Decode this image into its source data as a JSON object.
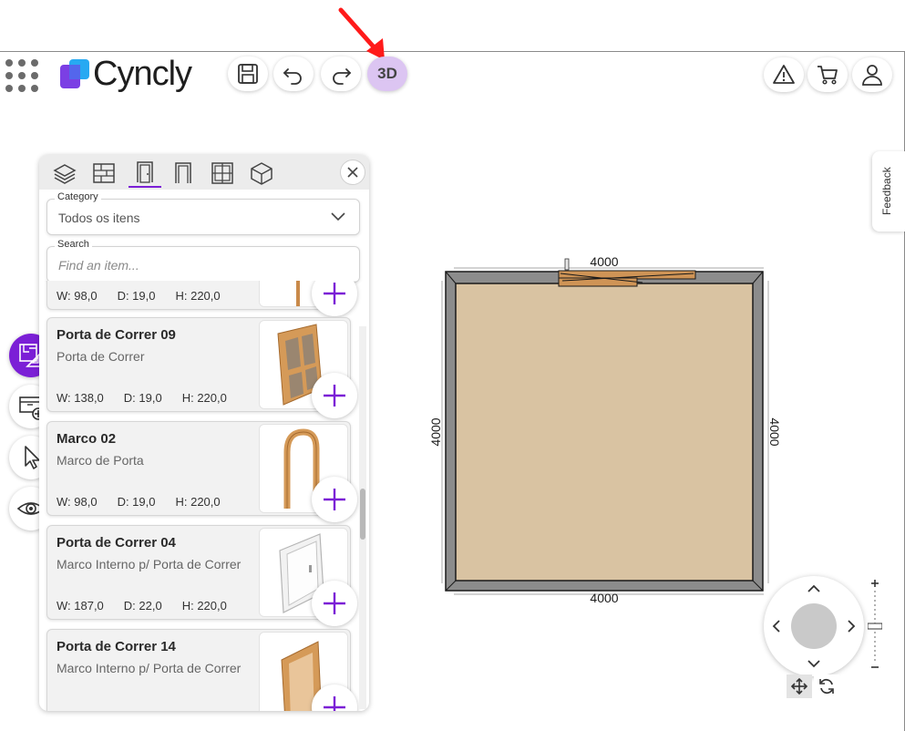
{
  "header": {
    "brand": "Cyncly",
    "mode_button_label": "3D",
    "brand_colors": {
      "accent": "#7b1fd6",
      "mode_pill": "#dcc5f2"
    },
    "icons": [
      "apps-grid-icon",
      "save-icon",
      "undo-icon",
      "redo-icon",
      "warning-icon",
      "cart-icon",
      "user-icon"
    ]
  },
  "feedback": {
    "label": "Feedback"
  },
  "panel": {
    "tabs": [
      {
        "name": "layers-icon"
      },
      {
        "name": "wall-icon"
      },
      {
        "name": "door-icon",
        "selected": true
      },
      {
        "name": "door-frame-icon"
      },
      {
        "name": "window-icon"
      },
      {
        "name": "cube-icon"
      }
    ],
    "category": {
      "label": "Category",
      "value": "Todos os itens"
    },
    "search": {
      "label": "Search",
      "placeholder": "Find an item..."
    },
    "items": [
      {
        "name": "",
        "description": "",
        "w": "W: 98,0",
        "d": "D: 19,0",
        "h": "H: 220,0"
      },
      {
        "name": "Porta de Correr 09",
        "description": "Porta de Correr",
        "w": "W: 138,0",
        "d": "D: 19,0",
        "h": "H: 220,0"
      },
      {
        "name": "Marco 02",
        "description": "Marco de Porta",
        "w": "W: 98,0",
        "d": "D: 19,0",
        "h": "H: 220,0"
      },
      {
        "name": "Porta de Correr 04",
        "description": "Marco Interno p/ Porta de Correr",
        "w": "W: 187,0",
        "d": "D: 22,0",
        "h": "H: 220,0"
      },
      {
        "name": "Porta de Correr 14",
        "description": "Marco Interno p/ Porta de Correr",
        "w": "",
        "d": "",
        "h": ""
      }
    ]
  },
  "plan": {
    "dim_top": "4000",
    "dim_bottom": "4000",
    "dim_left": "4000",
    "dim_right": "4000",
    "floor_color": "#d9c3a2",
    "wall_color": "#8c8c8c"
  }
}
